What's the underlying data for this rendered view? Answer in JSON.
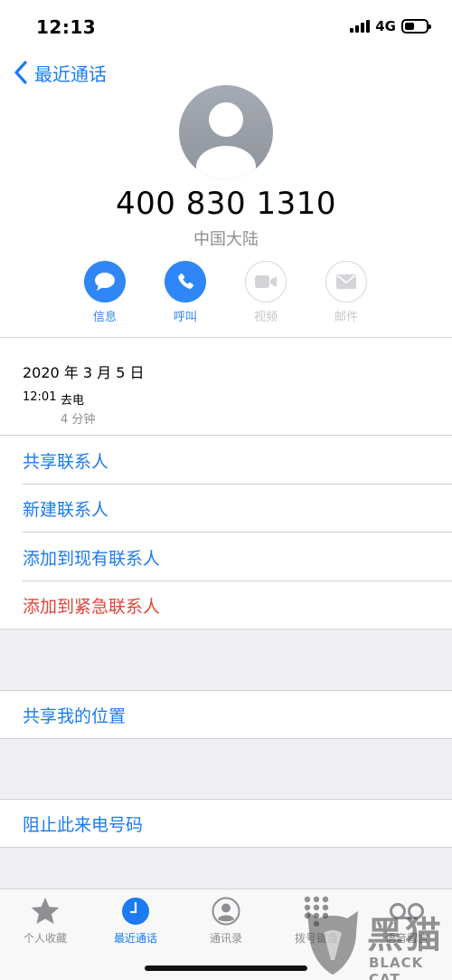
{
  "status": {
    "time": "12:13",
    "network": "4G"
  },
  "nav": {
    "back_label": "最近通话"
  },
  "contact": {
    "number": "400 830 1310",
    "region": "中国大陆"
  },
  "actions": [
    {
      "label": "信息",
      "icon": "message-icon",
      "enabled": true
    },
    {
      "label": "呼叫",
      "icon": "phone-icon",
      "enabled": true
    },
    {
      "label": "视频",
      "icon": "video-icon",
      "enabled": false
    },
    {
      "label": "邮件",
      "icon": "mail-icon",
      "enabled": false
    }
  ],
  "history": {
    "date": "2020 年 3 月 5 日",
    "time": "12:01",
    "type": "去电",
    "duration": "4 分钟"
  },
  "options": {
    "share_contact": "共享联系人",
    "new_contact": "新建联系人",
    "add_existing": "添加到现有联系人",
    "add_emergency": "添加到紧急联系人",
    "share_location": "共享我的位置",
    "block_caller": "阻止此来电号码"
  },
  "colors": {
    "accent": "#1a7bf2",
    "destructive": "#e0443a",
    "group_bg": "#efeff4"
  },
  "tabs": [
    {
      "label": "个人收藏",
      "icon": "star-icon",
      "active": false
    },
    {
      "label": "最近通话",
      "icon": "clock-icon",
      "active": true
    },
    {
      "label": "通讯录",
      "icon": "contacts-icon",
      "active": false
    },
    {
      "label": "拨号键盘",
      "icon": "keypad-icon",
      "active": false
    },
    {
      "label": "语音留言",
      "icon": "voicemail-icon",
      "active": false
    }
  ],
  "watermark": {
    "cn": "黑猫",
    "en": "BLACK CAT"
  }
}
